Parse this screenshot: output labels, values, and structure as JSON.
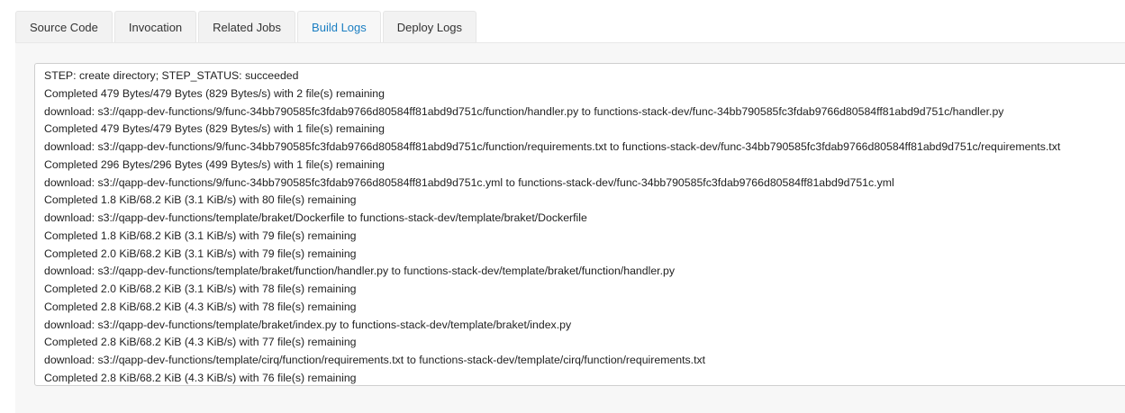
{
  "tabs": [
    {
      "label": "Source Code",
      "active": false
    },
    {
      "label": "Invocation",
      "active": false
    },
    {
      "label": "Related Jobs",
      "active": false
    },
    {
      "label": "Build Logs",
      "active": true
    },
    {
      "label": "Deploy Logs",
      "active": false
    }
  ],
  "colors": {
    "active_tab": "#1a7ec2",
    "panel_bg": "#f7f7f7"
  },
  "log_lines": [
    "STEP: create directory; STEP_STATUS: succeeded",
    "Completed 479 Bytes/479 Bytes (829 Bytes/s) with 2 file(s) remaining",
    "download: s3://qapp-dev-functions/9/func-34bb790585fc3fdab9766d80584ff81abd9d751c/function/handler.py to functions-stack-dev/func-34bb790585fc3fdab9766d80584ff81abd9d751c/handler.py",
    "Completed 479 Bytes/479 Bytes (829 Bytes/s) with 1 file(s) remaining",
    "download: s3://qapp-dev-functions/9/func-34bb790585fc3fdab9766d80584ff81abd9d751c/function/requirements.txt to functions-stack-dev/func-34bb790585fc3fdab9766d80584ff81abd9d751c/requirements.txt",
    "Completed 296 Bytes/296 Bytes (499 Bytes/s) with 1 file(s) remaining",
    "download: s3://qapp-dev-functions/9/func-34bb790585fc3fdab9766d80584ff81abd9d751c.yml to functions-stack-dev/func-34bb790585fc3fdab9766d80584ff81abd9d751c.yml",
    "Completed 1.8 KiB/68.2 KiB (3.1 KiB/s) with 80 file(s) remaining",
    "download: s3://qapp-dev-functions/template/braket/Dockerfile to functions-stack-dev/template/braket/Dockerfile",
    "Completed 1.8 KiB/68.2 KiB (3.1 KiB/s) with 79 file(s) remaining",
    "Completed 2.0 KiB/68.2 KiB (3.1 KiB/s) with 79 file(s) remaining",
    "download: s3://qapp-dev-functions/template/braket/function/handler.py to functions-stack-dev/template/braket/function/handler.py",
    "Completed 2.0 KiB/68.2 KiB (3.1 KiB/s) with 78 file(s) remaining",
    "Completed 2.8 KiB/68.2 KiB (4.3 KiB/s) with 78 file(s) remaining",
    "download: s3://qapp-dev-functions/template/braket/index.py to functions-stack-dev/template/braket/index.py",
    "Completed 2.8 KiB/68.2 KiB (4.3 KiB/s) with 77 file(s) remaining",
    "download: s3://qapp-dev-functions/template/cirq/function/requirements.txt to functions-stack-dev/template/cirq/function/requirements.txt",
    "Completed 2.8 KiB/68.2 KiB (4.3 KiB/s) with 76 file(s) remaining"
  ]
}
